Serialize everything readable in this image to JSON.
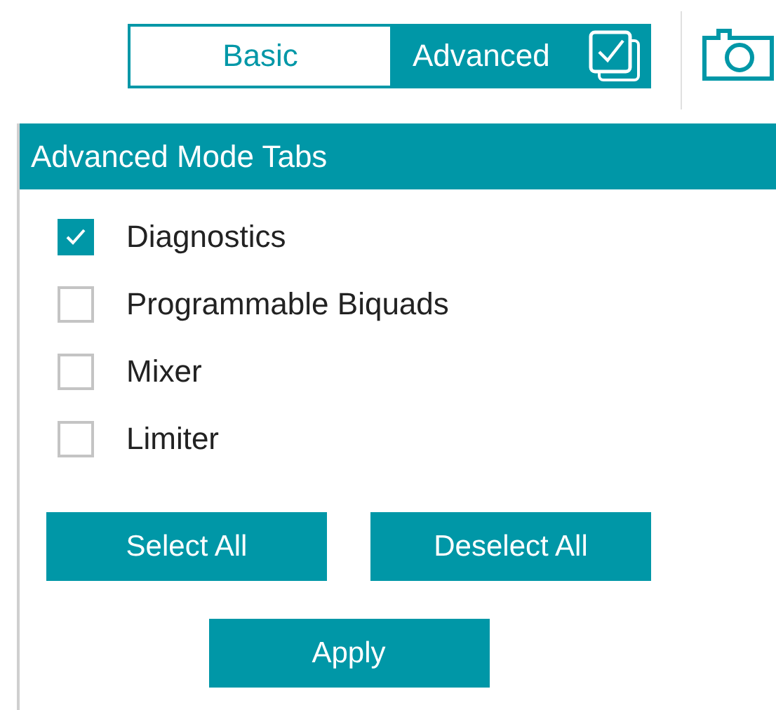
{
  "mode_toggle": [
    {
      "label": "Basic",
      "selected": false
    },
    {
      "label": "Advanced",
      "selected": true
    }
  ],
  "panel": {
    "title": "Advanced Mode Tabs",
    "items": [
      {
        "label": "Diagnostics",
        "checked": true
      },
      {
        "label": "Programmable Biquads",
        "checked": false
      },
      {
        "label": "Mixer",
        "checked": false
      },
      {
        "label": "Limiter",
        "checked": false
      }
    ],
    "buttons": [
      "Select All",
      "Deselect All"
    ],
    "apply_button": "Apply"
  }
}
